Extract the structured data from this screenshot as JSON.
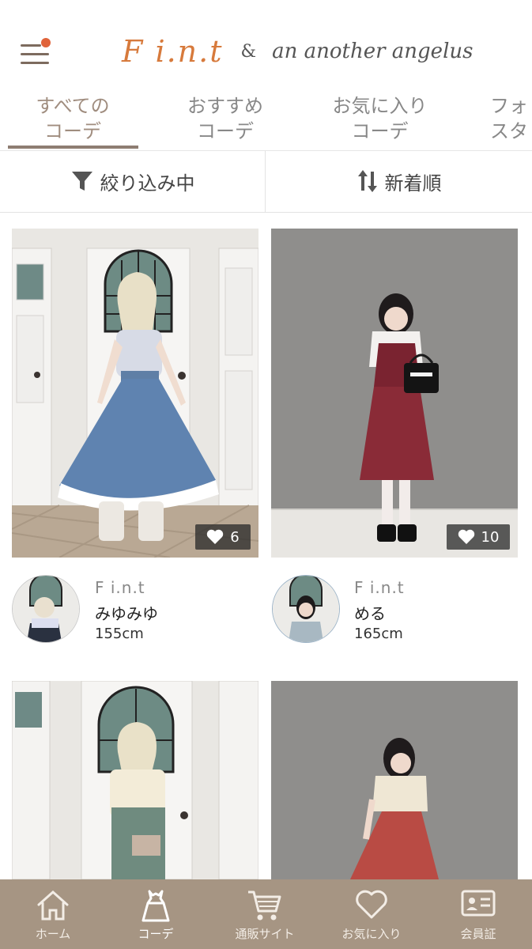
{
  "header": {
    "logo_fint": "F i.n.t",
    "logo_amp": "&",
    "logo_aaa": "an another angelus"
  },
  "tabs": [
    {
      "line1": "すべての",
      "line2": "コーデ"
    },
    {
      "line1": "おすすめ",
      "line2": "コーデ"
    },
    {
      "line1": "お気に入り",
      "line2": "コーデ"
    },
    {
      "line1": "フォ",
      "line2": "スタ"
    }
  ],
  "filters": {
    "filter_label": "絞り込み中",
    "sort_label": "新着順"
  },
  "cards": [
    {
      "likes": "6",
      "brand": "F i.n.t",
      "name": "みゆみゆ",
      "height": "155cm"
    },
    {
      "likes": "10",
      "brand": "F i.n.t",
      "name": "める",
      "height": "165cm"
    }
  ],
  "bottom_nav": [
    {
      "label": "ホーム",
      "icon": "home-icon"
    },
    {
      "label": "コーデ",
      "icon": "dress-icon"
    },
    {
      "label": "通販サイト",
      "icon": "cart-icon"
    },
    {
      "label": "お気に入り",
      "icon": "heart-icon"
    },
    {
      "label": "会員証",
      "icon": "member-card-icon"
    }
  ],
  "colors": {
    "accent": "#a69583",
    "logo_orange": "#d77a3c"
  }
}
